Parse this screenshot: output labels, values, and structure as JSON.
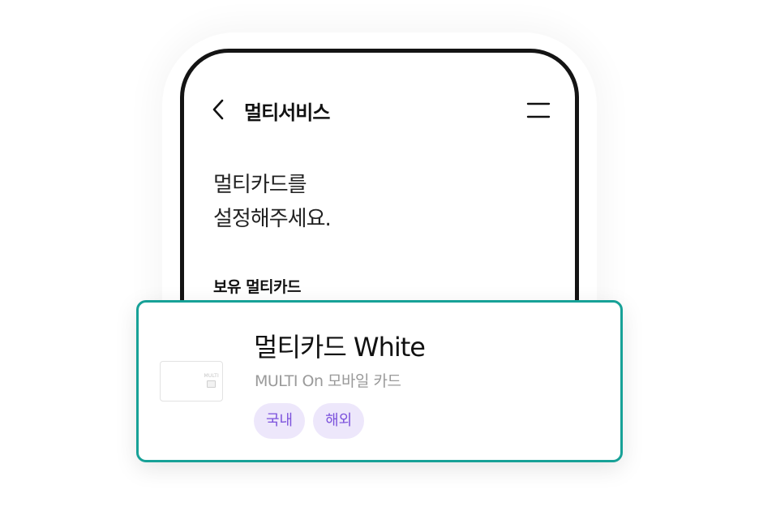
{
  "header": {
    "title": "멀티서비스",
    "back_icon": "chevron-left-icon",
    "menu_icon": "menu-icon"
  },
  "main": {
    "headline_line1": "멀티카드를",
    "headline_line2": "설정해주세요.",
    "section_label": "보유 멀티카드"
  },
  "card": {
    "name": "멀티카드 White",
    "subtitle": "MULTI On 모바일 카드",
    "image_text": "MULTI",
    "tags": [
      "국내",
      "해외"
    ]
  },
  "colors": {
    "border_accent": "#17a197",
    "tag_bg": "#ede7fb",
    "tag_text": "#7c52dc"
  }
}
